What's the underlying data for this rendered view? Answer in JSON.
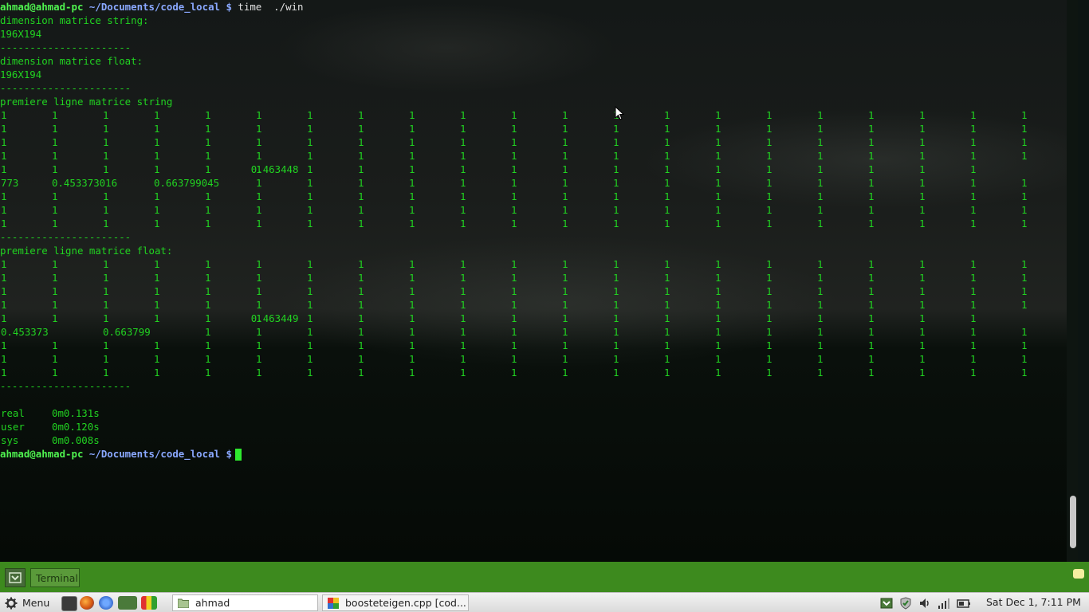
{
  "terminal": {
    "prompt": {
      "userhost": "ahmad@ahmad-pc",
      "path": "~/Documents/code_local",
      "symbol": "$"
    },
    "command": "time  ./win",
    "output_lines": [
      "dimension matrice string:",
      "196X194",
      "----------------------",
      "dimension matrice float:",
      "196X194",
      "----------------------",
      "premiere ligne matrice string"
    ],
    "string_rows": [
      [
        "1",
        "1",
        "1",
        "1",
        "1",
        "1",
        "1",
        "1",
        "1",
        "1",
        "1",
        "1",
        "1",
        "1",
        "1",
        "1",
        "1",
        "1",
        "1",
        "1",
        "1",
        "1"
      ],
      [
        "1",
        "1",
        "1",
        "1",
        "1",
        "1",
        "1",
        "1",
        "1",
        "1",
        "1",
        "1",
        "1",
        "1",
        "1",
        "1",
        "1",
        "1",
        "1",
        "1",
        "1",
        "1"
      ],
      [
        "1",
        "1",
        "1",
        "1",
        "1",
        "1",
        "1",
        "1",
        "1",
        "1",
        "1",
        "1",
        "1",
        "1",
        "1",
        "1",
        "1",
        "1",
        "1",
        "1",
        "1",
        "1"
      ],
      [
        "1",
        "1",
        "1",
        "1",
        "1",
        "1",
        "1",
        "1",
        "1",
        "1",
        "1",
        "1",
        "1",
        "1",
        "1",
        "1",
        "1",
        "1",
        "1",
        "1",
        "1",
        "1"
      ],
      [
        "1",
        "1",
        "1",
        "1",
        "1",
        "1",
        "1",
        "1",
        "1",
        "1",
        "1",
        "1",
        "1",
        "1",
        "1",
        "1",
        "1",
        "1",
        "1",
        "1",
        "0.463448"
      ],
      [
        "773",
        "0.453373016",
        "",
        "0.663799045",
        "",
        "1",
        "1",
        "1",
        "1",
        "1",
        "1",
        "1",
        "1",
        "1",
        "1",
        "1",
        "1",
        "1",
        "1",
        "1",
        "1",
        "1"
      ],
      [
        "1",
        "1",
        "1",
        "1",
        "1",
        "1",
        "1",
        "1",
        "1",
        "1",
        "1",
        "1",
        "1",
        "1",
        "1",
        "1",
        "1",
        "1",
        "1",
        "1",
        "1",
        "1"
      ],
      [
        "1",
        "1",
        "1",
        "1",
        "1",
        "1",
        "1",
        "1",
        "1",
        "1",
        "1",
        "1",
        "1",
        "1",
        "1",
        "1",
        "1",
        "1",
        "1",
        "1",
        "1",
        "1"
      ],
      [
        "1",
        "1",
        "1",
        "1",
        "1",
        "1",
        "1",
        "1",
        "1",
        "1",
        "1",
        "1",
        "1",
        "1",
        "1",
        "1",
        "1",
        "1",
        "1",
        "1",
        "1",
        "1"
      ]
    ],
    "separator": "----------------------",
    "float_header": "premiere ligne matrice float:",
    "float_rows": [
      [
        "1",
        "1",
        "1",
        "1",
        "1",
        "1",
        "1",
        "1",
        "1",
        "1",
        "1",
        "1",
        "1",
        "1",
        "1",
        "1",
        "1",
        "1",
        "1",
        "1",
        "1",
        "1"
      ],
      [
        "1",
        "1",
        "1",
        "1",
        "1",
        "1",
        "1",
        "1",
        "1",
        "1",
        "1",
        "1",
        "1",
        "1",
        "1",
        "1",
        "1",
        "1",
        "1",
        "1",
        "1",
        "1"
      ],
      [
        "1",
        "1",
        "1",
        "1",
        "1",
        "1",
        "1",
        "1",
        "1",
        "1",
        "1",
        "1",
        "1",
        "1",
        "1",
        "1",
        "1",
        "1",
        "1",
        "1",
        "1",
        "1"
      ],
      [
        "1",
        "1",
        "1",
        "1",
        "1",
        "1",
        "1",
        "1",
        "1",
        "1",
        "1",
        "1",
        "1",
        "1",
        "1",
        "1",
        "1",
        "1",
        "1",
        "1",
        "1",
        "1"
      ],
      [
        "1",
        "1",
        "1",
        "1",
        "1",
        "1",
        "1",
        "1",
        "1",
        "1",
        "1",
        "1",
        "1",
        "1",
        "1",
        "1",
        "1",
        "1",
        "1",
        "1",
        "0.463449"
      ],
      [
        "0.453373",
        "",
        "0.663799",
        "",
        "1",
        "1",
        "1",
        "1",
        "1",
        "1",
        "1",
        "1",
        "1",
        "1",
        "1",
        "1",
        "1",
        "1",
        "1",
        "1",
        "1",
        "1"
      ],
      [
        "1",
        "1",
        "1",
        "1",
        "1",
        "1",
        "1",
        "1",
        "1",
        "1",
        "1",
        "1",
        "1",
        "1",
        "1",
        "1",
        "1",
        "1",
        "1",
        "1",
        "1",
        "1"
      ],
      [
        "1",
        "1",
        "1",
        "1",
        "1",
        "1",
        "1",
        "1",
        "1",
        "1",
        "1",
        "1",
        "1",
        "1",
        "1",
        "1",
        "1",
        "1",
        "1",
        "1",
        "1",
        "1"
      ],
      [
        "1",
        "1",
        "1",
        "1",
        "1",
        "1",
        "1",
        "1",
        "1",
        "1",
        "1",
        "1",
        "1",
        "1",
        "1",
        "1",
        "1",
        "1",
        "1",
        "1",
        "1"
      ]
    ],
    "timing": [
      {
        "label": "real",
        "value": "0m0.131s"
      },
      {
        "label": "user",
        "value": "0m0.120s"
      },
      {
        "label": "sys",
        "value": "0m0.008s"
      }
    ]
  },
  "top_panel": {
    "terminal_tab": "Terminal"
  },
  "bottom_panel": {
    "menu_label": "Menu",
    "quick_launch": [
      "terminal-launcher-icon",
      "firefox-icon",
      "chromium-icon",
      "mint-update-icon",
      "color-app-icon"
    ],
    "tasks": [
      {
        "label": "ahmad",
        "icon": "folder-icon"
      },
      {
        "label": "boosteteigen.cpp [cod...",
        "icon": "editor-icon"
      }
    ],
    "tray_icons": [
      "update-manager-icon",
      "shield-icon",
      "volume-icon",
      "network-signal-icon",
      "battery-icon"
    ],
    "clock": "Sat Dec  1,  7:11 PM"
  },
  "colors": {
    "terminal_text": "#21d321",
    "prompt_user": "#4ff24f",
    "prompt_path": "#8aa8ff",
    "panel_green": "#3d8a1e"
  }
}
